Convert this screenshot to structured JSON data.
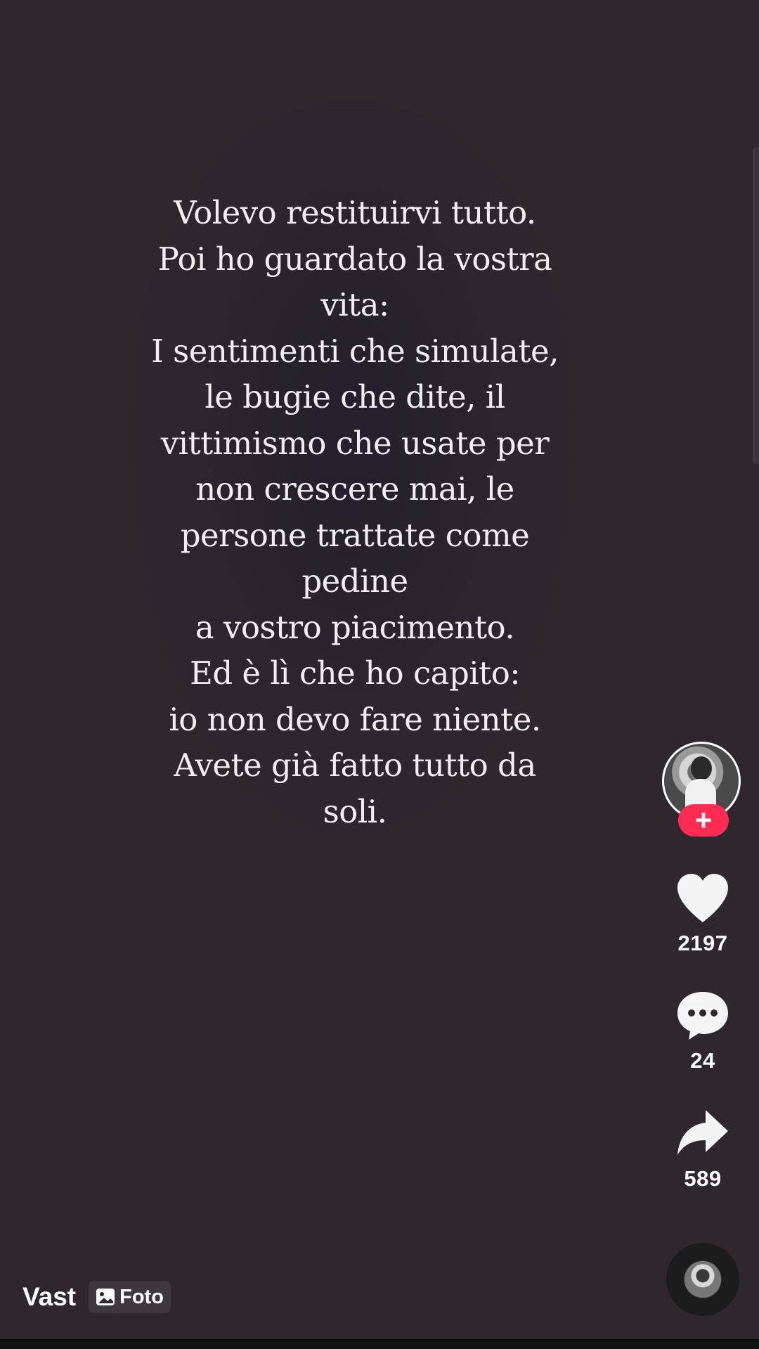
{
  "post": {
    "text_lines": [
      "Volevo restituirvi tutto.",
      "Poi ho guardato la vostra",
      "vita:",
      "I sentimenti che simulate,",
      "le bugie che dite, il",
      "vittimismo che usate per",
      "non crescere mai, le",
      "persone trattate come",
      "pedine",
      "a vostro piacimento.",
      "Ed è lì che ho capito:",
      "io non devo fare niente.",
      "Avete già fatto tutto da",
      "soli."
    ]
  },
  "actions": {
    "follow_symbol": "+",
    "likes": "2197",
    "comments": "24",
    "shares": "589"
  },
  "author": {
    "username": "Vast"
  },
  "content_type": {
    "label": "Foto",
    "icon": "photo-icon"
  },
  "colors": {
    "background": "#2f262e",
    "follow_accent": "#fe2c55",
    "text": "#f2ecf3"
  }
}
